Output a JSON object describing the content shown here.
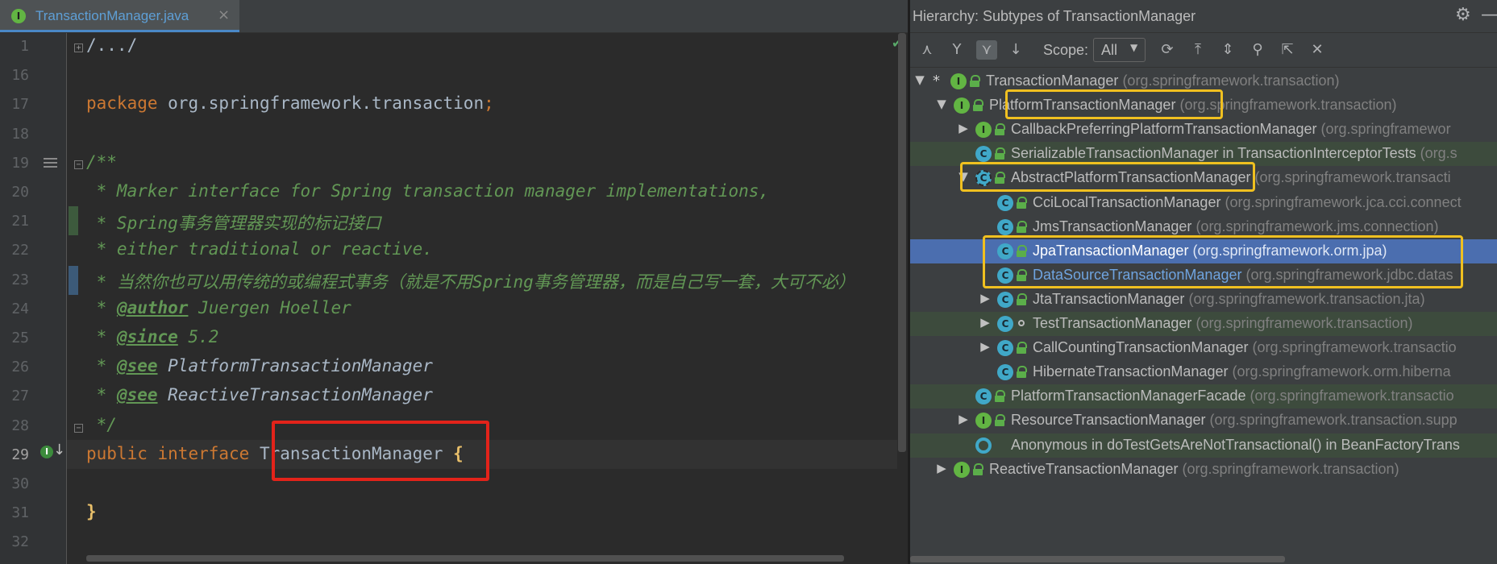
{
  "editor": {
    "tab": {
      "label": "TransactionManager.java",
      "icon": "I",
      "close": "×"
    },
    "lines": [
      {
        "n": "1",
        "segs": [
          {
            "t": "/.../",
            "c": "plain"
          }
        ]
      },
      {
        "n": "16",
        "segs": []
      },
      {
        "n": "17",
        "segs": [
          {
            "t": "package ",
            "c": "kw"
          },
          {
            "t": "org.springframework.transaction",
            "c": "plain"
          },
          {
            "t": ";",
            "c": "kw"
          }
        ]
      },
      {
        "n": "18",
        "segs": []
      },
      {
        "n": "19",
        "segs": [
          {
            "t": "/**",
            "c": "cm"
          }
        ]
      },
      {
        "n": "20",
        "segs": [
          {
            "t": " * Marker interface for Spring transaction manager implementations,",
            "c": "cm"
          }
        ]
      },
      {
        "n": "21",
        "segs": [
          {
            "t": " * Spring事务管理器实现的标记接口",
            "c": "cm"
          }
        ]
      },
      {
        "n": "22",
        "segs": [
          {
            "t": " * either traditional or reactive.",
            "c": "cm"
          }
        ]
      },
      {
        "n": "23",
        "segs": [
          {
            "t": " * 当然你也可以用传统的或编程式事务（就是不用Spring事务管理器，而是自己写一套，大可不必）",
            "c": "cm"
          }
        ]
      },
      {
        "n": "24",
        "segs": [
          {
            "t": " * ",
            "c": "cm"
          },
          {
            "t": "@author",
            "c": "tag"
          },
          {
            "t": " Juergen Hoeller",
            "c": "cm"
          }
        ]
      },
      {
        "n": "25",
        "segs": [
          {
            "t": " * ",
            "c": "cm"
          },
          {
            "t": "@since",
            "c": "tag"
          },
          {
            "t": " 5.2",
            "c": "cm"
          }
        ]
      },
      {
        "n": "26",
        "segs": [
          {
            "t": " * ",
            "c": "cm"
          },
          {
            "t": "@see",
            "c": "tag"
          },
          {
            "t": " PlatformTransactionManager",
            "c": "tref"
          }
        ]
      },
      {
        "n": "27",
        "segs": [
          {
            "t": " * ",
            "c": "cm"
          },
          {
            "t": "@see",
            "c": "tag"
          },
          {
            "t": " ReactiveTransactionManager",
            "c": "tref"
          }
        ]
      },
      {
        "n": "28",
        "segs": [
          {
            "t": " */",
            "c": "cm"
          }
        ]
      },
      {
        "n": "29",
        "segs": [
          {
            "t": "public ",
            "c": "kw"
          },
          {
            "t": "interface ",
            "c": "kw"
          },
          {
            "t": "TransactionManager ",
            "c": "plain"
          },
          {
            "t": "{",
            "c": "brace"
          }
        ]
      },
      {
        "n": "30",
        "segs": []
      },
      {
        "n": "31",
        "segs": [
          {
            "t": "}",
            "c": "brace"
          }
        ]
      },
      {
        "n": "32",
        "segs": []
      }
    ],
    "implemented_marker": "I",
    "implemented_arrow": "↓"
  },
  "hierarchy": {
    "title": "Hierarchy:  Subtypes of TransactionManager",
    "scope_label": "Scope:",
    "scope_value": "All",
    "toolbar": [
      {
        "name": "supertypes-icon",
        "glyph": "⋏"
      },
      {
        "name": "class-hierarchy-icon",
        "glyph": "Y"
      },
      {
        "name": "subtypes-icon",
        "glyph": "⋎"
      },
      {
        "name": "sort-alpha-icon",
        "glyph": "↓"
      },
      {
        "name": "refresh-icon",
        "glyph": "⟳"
      },
      {
        "name": "export-icon",
        "glyph": "⤒"
      },
      {
        "name": "expand-all-icon",
        "glyph": "⇕"
      },
      {
        "name": "pin-icon",
        "glyph": "⚲"
      },
      {
        "name": "open-icon",
        "glyph": "⇱"
      },
      {
        "name": "close-icon",
        "glyph": "✕"
      }
    ],
    "rows": [
      {
        "arrow": "▼",
        "star": "*",
        "kind": "i",
        "lock": true,
        "name": "TransactionManager",
        "pkg": "(org.springframework.transaction)",
        "style": ""
      },
      {
        "arrow": "▼",
        "kind": "i",
        "lock": true,
        "name": "PlatformTransactionManager",
        "pkg": "(org.springframework.transaction)",
        "style": ""
      },
      {
        "arrow": "▶",
        "kind": "i",
        "lock": true,
        "name": "CallbackPreferringPlatformTransactionManager",
        "pkg": "(org.springframewor",
        "style": ""
      },
      {
        "arrow": "",
        "kind": "c",
        "lock": true,
        "name": "SerializableTransactionManager in TransactionInterceptorTests",
        "pkg": "(org.s",
        "style": "hl"
      },
      {
        "arrow": "▼",
        "kind": "a",
        "lock": true,
        "name": "AbstractPlatformTransactionManager",
        "pkg": "(org.springframework.transacti",
        "style": ""
      },
      {
        "arrow": "",
        "kind": "c",
        "lock": true,
        "name": "CciLocalTransactionManager",
        "pkg": "(org.springframework.jca.cci.connect",
        "style": ""
      },
      {
        "arrow": "",
        "kind": "c",
        "lock": true,
        "name": "JmsTransactionManager",
        "pkg": "(org.springframework.jms.connection)",
        "style": ""
      },
      {
        "arrow": "",
        "kind": "c",
        "lock": true,
        "name": "JpaTransactionManager",
        "pkg": "(org.springframework.orm.jpa)",
        "style": "sel"
      },
      {
        "arrow": "",
        "kind": "c",
        "lock": true,
        "name": "DataSourceTransactionManager",
        "pkg": "(org.springframework.jdbc.datas",
        "style": "blue"
      },
      {
        "arrow": "▶",
        "kind": "c",
        "lock": true,
        "name": "JtaTransactionManager",
        "pkg": "(org.springframework.transaction.jta)",
        "style": ""
      },
      {
        "arrow": "▶",
        "kind": "c",
        "lock": false,
        "name": "TestTransactionManager",
        "pkg": "(org.springframework.transaction)",
        "style": "hl"
      },
      {
        "arrow": "▶",
        "kind": "c",
        "lock": true,
        "name": "CallCountingTransactionManager",
        "pkg": "(org.springframework.transactio",
        "style": ""
      },
      {
        "arrow": "",
        "kind": "c",
        "lock": true,
        "name": "HibernateTransactionManager",
        "pkg": "(org.springframework.orm.hiberna",
        "style": ""
      },
      {
        "arrow": "",
        "kind": "c",
        "lock": true,
        "name": "PlatformTransactionManagerFacade",
        "pkg": "(org.springframework.transactio",
        "style": "hl"
      },
      {
        "arrow": "▶",
        "kind": "i",
        "lock": true,
        "name": "ResourceTransactionManager",
        "pkg": "(org.springframework.transaction.supp",
        "style": ""
      },
      {
        "arrow": "",
        "kind": "anon",
        "lock": false,
        "name": "Anonymous in doTestGetsAreNotTransactional() in BeanFactoryTrans",
        "pkg": "",
        "style": "hl"
      },
      {
        "arrow": "▶",
        "kind": "i",
        "lock": true,
        "name": "ReactiveTransactionManager",
        "pkg": "(org.springframework.transaction)",
        "style": ""
      }
    ]
  },
  "colors": {
    "highlight_red": "#e3231a",
    "highlight_yellow": "#f0c020",
    "selection": "#4b6eaf"
  }
}
